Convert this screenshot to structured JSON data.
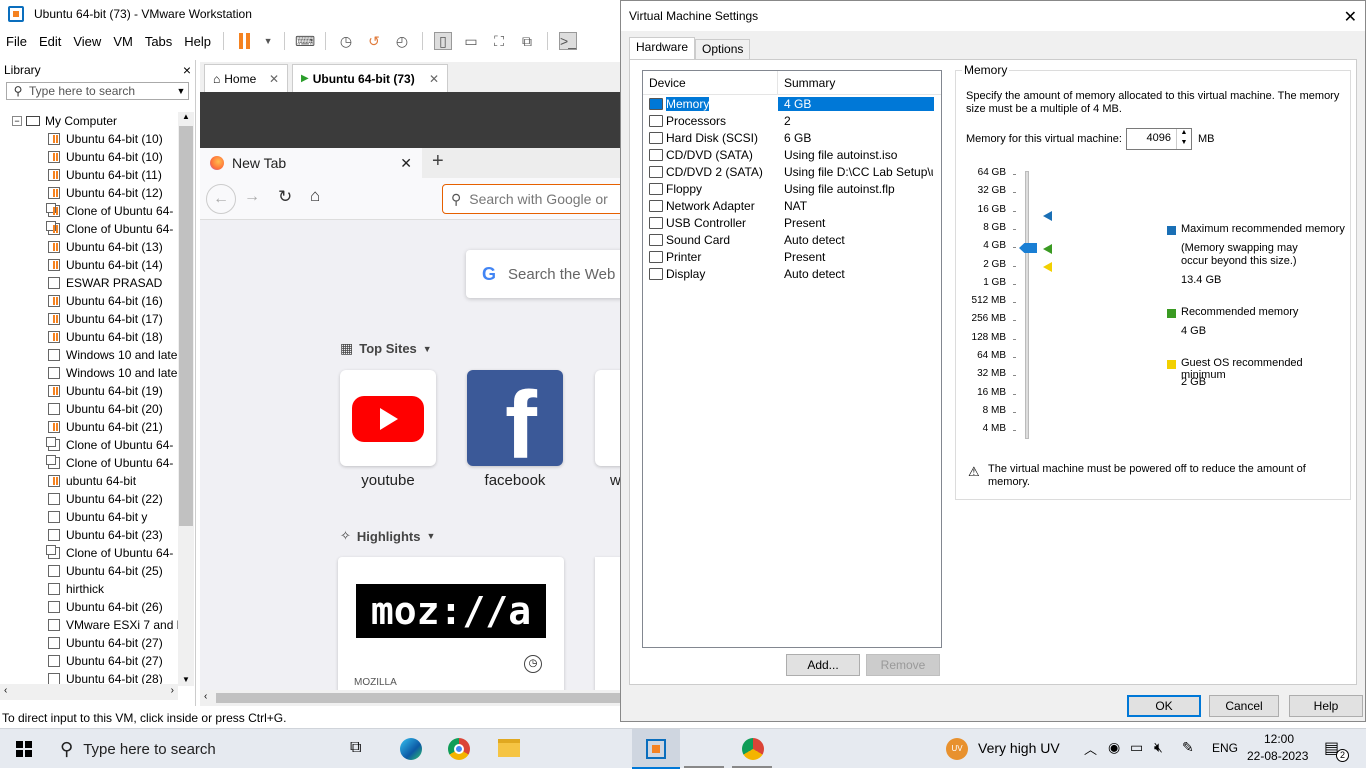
{
  "window": {
    "title": "Ubuntu 64-bit (73) - VMware Workstation",
    "menus": [
      "File",
      "Edit",
      "View",
      "VM",
      "Tabs",
      "Help"
    ]
  },
  "library": {
    "title": "Library",
    "close": "×",
    "search_placeholder": "Type here to search",
    "root": "My Computer",
    "items": [
      {
        "label": "Ubuntu 64-bit (10)",
        "icon": "vm-running"
      },
      {
        "label": "Ubuntu 64-bit (10)",
        "icon": "vm-running"
      },
      {
        "label": "Ubuntu 64-bit (11)",
        "icon": "vm-running"
      },
      {
        "label": "Ubuntu 64-bit (12)",
        "icon": "vm-running"
      },
      {
        "label": "Clone of Ubuntu 64-",
        "icon": "vm-clone-running"
      },
      {
        "label": "Clone of Ubuntu 64-",
        "icon": "vm-clone-running"
      },
      {
        "label": "Ubuntu 64-bit (13)",
        "icon": "vm-running"
      },
      {
        "label": "Ubuntu 64-bit (14)",
        "icon": "vm-running"
      },
      {
        "label": "ESWAR PRASAD",
        "icon": "vm"
      },
      {
        "label": "Ubuntu 64-bit (16)",
        "icon": "vm-running"
      },
      {
        "label": "Ubuntu 64-bit (17)",
        "icon": "vm-running"
      },
      {
        "label": "Ubuntu 64-bit (18)",
        "icon": "vm-running"
      },
      {
        "label": "Windows 10 and late",
        "icon": "vm"
      },
      {
        "label": "Windows 10 and late",
        "icon": "vm"
      },
      {
        "label": "Ubuntu 64-bit (19)",
        "icon": "vm-running"
      },
      {
        "label": "Ubuntu 64-bit (20)",
        "icon": "vm"
      },
      {
        "label": "Ubuntu 64-bit (21)",
        "icon": "vm-running"
      },
      {
        "label": "Clone of Ubuntu 64-",
        "icon": "vm-clone"
      },
      {
        "label": "Clone of Ubuntu 64-",
        "icon": "vm-clone"
      },
      {
        "label": "ubuntu 64-bit",
        "icon": "vm-running"
      },
      {
        "label": "Ubuntu 64-bit (22)",
        "icon": "vm"
      },
      {
        "label": "Ubuntu 64-bit y",
        "icon": "vm"
      },
      {
        "label": "Ubuntu 64-bit (23)",
        "icon": "vm"
      },
      {
        "label": "Clone of Ubuntu 64-",
        "icon": "vm-clone"
      },
      {
        "label": "Ubuntu 64-bit (25)",
        "icon": "vm"
      },
      {
        "label": "hirthick",
        "icon": "vm"
      },
      {
        "label": "Ubuntu 64-bit (26)",
        "icon": "vm"
      },
      {
        "label": "VMware ESXi 7 and la",
        "icon": "vm"
      },
      {
        "label": "Ubuntu 64-bit (27)",
        "icon": "vm"
      },
      {
        "label": "Ubuntu 64-bit (27)",
        "icon": "vm"
      },
      {
        "label": "Ubuntu 64-bit (28)",
        "icon": "vm"
      }
    ]
  },
  "tabs": {
    "home": "Home",
    "vm": "Ubuntu 64-bit (73)"
  },
  "firefox": {
    "tab": "New Tab",
    "url_placeholder": "Search with Google or",
    "search_placeholder": "Search the Web",
    "top_sites": "Top Sites",
    "sites": [
      "youtube",
      "facebook",
      "w"
    ],
    "highlights": "Highlights",
    "highlight_card": "MOZILLA",
    "mozilla_logo": "moz://a"
  },
  "status": "To direct input to this VM, click inside or press Ctrl+G.",
  "dialog": {
    "title": "Virtual Machine Settings",
    "tabs": [
      "Hardware",
      "Options"
    ],
    "col_device": "Device",
    "col_summary": "Summary",
    "devices": [
      {
        "name": "Memory",
        "summary": "4 GB",
        "icon": "memory-icon"
      },
      {
        "name": "Processors",
        "summary": "2",
        "icon": "cpu-icon"
      },
      {
        "name": "Hard Disk (SCSI)",
        "summary": "6 GB",
        "icon": "disk-icon"
      },
      {
        "name": "CD/DVD (SATA)",
        "summary": "Using file autoinst.iso",
        "icon": "cd-icon"
      },
      {
        "name": "CD/DVD 2 (SATA)",
        "summary": "Using file D:\\CC Lab Setup\\u...",
        "icon": "cd-icon"
      },
      {
        "name": "Floppy",
        "summary": "Using file autoinst.flp",
        "icon": "floppy-icon"
      },
      {
        "name": "Network Adapter",
        "summary": "NAT",
        "icon": "network-icon"
      },
      {
        "name": "USB Controller",
        "summary": "Present",
        "icon": "usb-icon"
      },
      {
        "name": "Sound Card",
        "summary": "Auto detect",
        "icon": "sound-icon"
      },
      {
        "name": "Printer",
        "summary": "Present",
        "icon": "printer-icon"
      },
      {
        "name": "Display",
        "summary": "Auto detect",
        "icon": "display-icon"
      }
    ],
    "add": "Add...",
    "remove": "Remove",
    "memory": {
      "group": "Memory",
      "desc": "Specify the amount of memory allocated to this virtual machine. The memory size must be a multiple of 4 MB.",
      "label": "Memory for this virtual machine:",
      "value": "4096",
      "unit": "MB",
      "scale": [
        "64 GB",
        "32 GB",
        "16 GB",
        "8 GB",
        "4 GB",
        "2 GB",
        "1 GB",
        "512 MB",
        "256 MB",
        "128 MB",
        "64 MB",
        "32 MB",
        "16 MB",
        "8 MB",
        "4 MB"
      ],
      "legend_max": "Maximum recommended memory",
      "legend_max_note": "(Memory swapping may occur beyond this size.)",
      "legend_max_value": "13.4 GB",
      "legend_rec": "Recommended memory",
      "legend_rec_value": "4 GB",
      "legend_min": "Guest OS recommended minimum",
      "legend_min_value": "2 GB",
      "warning": "The virtual machine must be powered off to reduce the amount of memory.",
      "colors": {
        "max": "#1a6fb5",
        "rec": "#3a9a22",
        "min": "#f2d000"
      }
    },
    "ok": "OK",
    "cancel": "Cancel",
    "help": "Help"
  },
  "taskbar": {
    "search": "Type here to search",
    "weather": "Very high UV",
    "weather_badge": "UV",
    "lang": "ENG",
    "time": "12:00",
    "date": "22-08-2023",
    "notif": "2"
  }
}
